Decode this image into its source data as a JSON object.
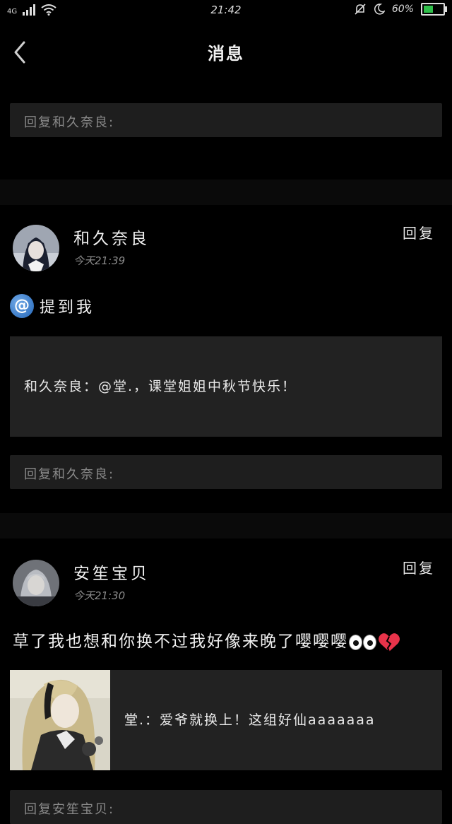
{
  "status_bar": {
    "network": "4G",
    "time": "21:42",
    "battery_percent": "60%",
    "battery_level": 0.6,
    "icons": [
      "signal-icon",
      "wifi-icon",
      "mute-icon",
      "moon-icon",
      "battery-icon"
    ]
  },
  "header": {
    "title": "消息",
    "back_icon": "chevron-left-icon"
  },
  "messages": [
    {
      "reply_placeholder_top": "回复和久奈良:",
      "user": "和久奈良",
      "time": "今天21:39",
      "reply_label": "回复",
      "mention_label": "提到我",
      "quote": "和久奈良：@堂.，课堂姐姐中秋节快乐！",
      "reply_placeholder": "回复和久奈良:"
    },
    {
      "user": "安笙宝贝",
      "time": "今天21:30",
      "reply_label": "回复",
      "comment": "草了我也想和你换不过我好像来晚了嘤嘤嘤",
      "quote": "堂.：爱爷就换上！这组好仙aaaaaaa",
      "reply_placeholder": "回复安笙宝贝:"
    }
  ],
  "colors": {
    "background": "#000000",
    "panel": "#222222",
    "reply_box": "#1e1e1e",
    "mention_blue": "#2466b8",
    "heart": "#e8334a"
  }
}
